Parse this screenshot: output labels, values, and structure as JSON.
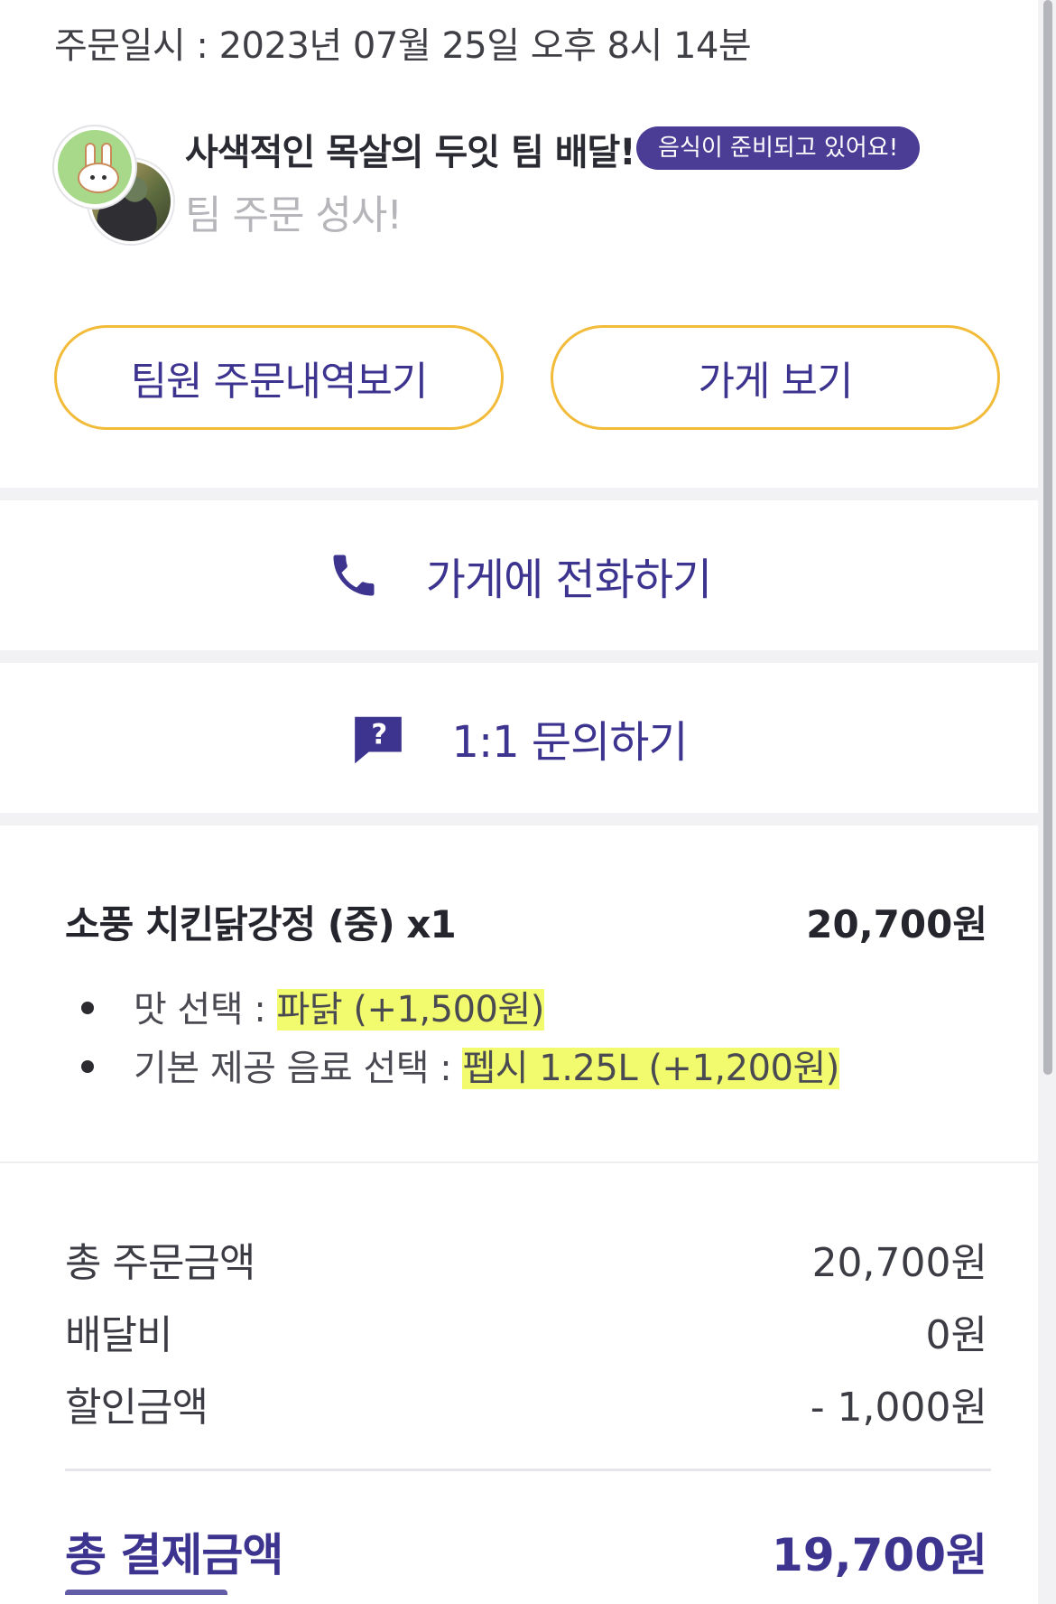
{
  "order": {
    "datetime": "주문일시 : 2023년 07월 25일 오후 8시 14분"
  },
  "team": {
    "title": "사색적인 목살의 두잇 팀 배달!",
    "status_badge": "음식이 준비되고 있어요!",
    "subtitle": "팀 주문 성사!"
  },
  "buttons": {
    "team_orders": "팀원 주문내역보기",
    "view_store": "가게 보기"
  },
  "actions": {
    "call_store": "가게에 전화하기",
    "inquiry": "1:1 문의하기"
  },
  "item": {
    "name": "소풍 치킨닭강정 (중) x1",
    "price": "20,700원",
    "options": [
      {
        "label": "맛 선택 : ",
        "value": "파닭 (+1,500원)"
      },
      {
        "label": "기본 제공 음료 선택 : ",
        "value": "펩시 1.25L (+1,200원)"
      }
    ]
  },
  "summary": {
    "order_total_label": "총 주문금액",
    "order_total_value": "20,700원",
    "delivery_label": "배달비",
    "delivery_value": "0원",
    "discount_label": "할인금액",
    "discount_value": "- 1,000원",
    "payment_total_label": "총 결제금액",
    "payment_total_value": "19,700원"
  },
  "colors": {
    "accent": "#3d3490",
    "badge": "#4b3d96",
    "button_border": "#f2bb3a",
    "highlight": "#eefa3c"
  },
  "icons": [
    "phone-icon",
    "question-chat-icon",
    "bunny-avatar",
    "user-avatar"
  ]
}
